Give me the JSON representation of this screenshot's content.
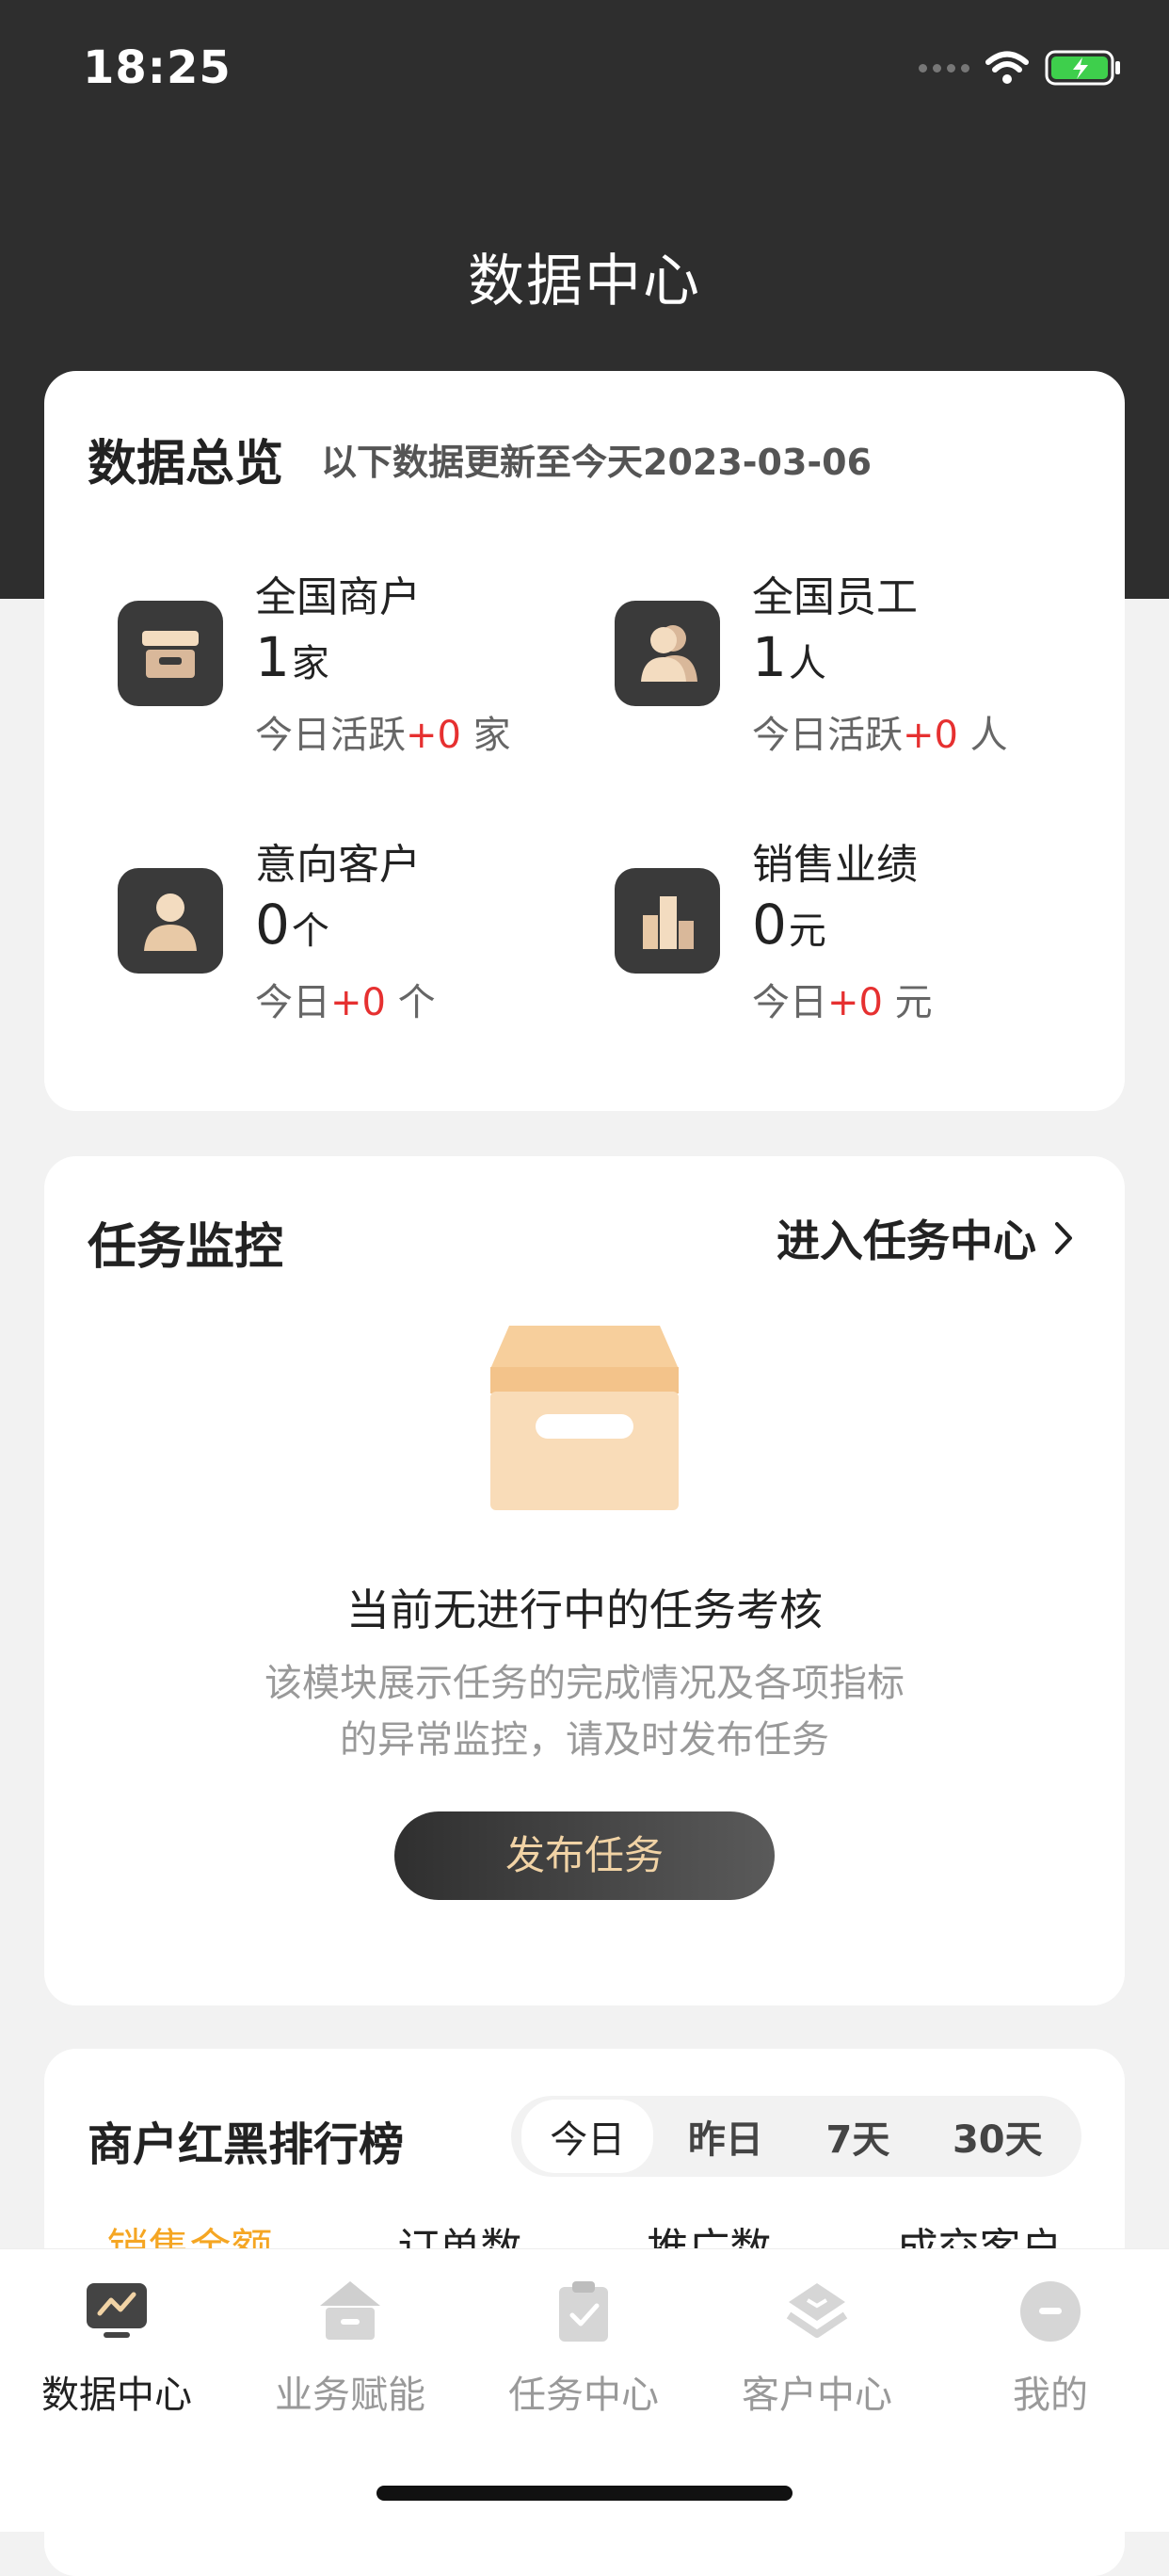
{
  "status": {
    "time": "18:25"
  },
  "page_title": "数据中心",
  "overview": {
    "title": "数据总览",
    "update_note": "以下数据更新至今天2023-03-06",
    "stats": [
      {
        "label": "全国商户",
        "value": "1",
        "unit": "家",
        "sub_prefix": "今日活跃",
        "sub_delta": "+0",
        "sub_unit": " 家",
        "icon": "store-icon"
      },
      {
        "label": "全国员工",
        "value": "1",
        "unit": "人",
        "sub_prefix": "今日活跃",
        "sub_delta": "+0",
        "sub_unit": " 人",
        "icon": "staff-icon"
      },
      {
        "label": "意向客户",
        "value": "0",
        "unit": "个",
        "sub_prefix": "今日",
        "sub_delta": "+0",
        "sub_unit": " 个",
        "icon": "customer-icon"
      },
      {
        "label": "销售业绩",
        "value": "0",
        "unit": "元",
        "sub_prefix": "今日",
        "sub_delta": "+0",
        "sub_unit": " 元",
        "icon": "sales-chart-icon"
      }
    ]
  },
  "task_monitor": {
    "title": "任务监控",
    "link_label": "进入任务中心",
    "empty_title": "当前无进行中的任务考核",
    "empty_desc_line1": "该模块展示任务的完成情况及各项指标",
    "empty_desc_line2": "的异常监控，请及时发布任务",
    "publish_label": "发布任务"
  },
  "ranking": {
    "title": "商户红黑排行榜",
    "periods": [
      "今日",
      "昨日",
      "7天",
      "30天"
    ],
    "active_period": "今日",
    "metrics": [
      "销售金额",
      "订单数",
      "推广数",
      "成交客户"
    ],
    "active_metric": "销售金额"
  },
  "tabbar": {
    "items": [
      {
        "label": "数据中心",
        "icon": "data-center-icon",
        "active": true
      },
      {
        "label": "业务赋能",
        "icon": "business-icon",
        "active": false
      },
      {
        "label": "任务中心",
        "icon": "task-icon",
        "active": false
      },
      {
        "label": "客户中心",
        "icon": "customer-center-icon",
        "active": false
      },
      {
        "label": "我的",
        "icon": "profile-icon",
        "active": false
      }
    ]
  },
  "colors": {
    "header": "#2e2e2e",
    "accent": "#f5a623",
    "delta": "#e63030",
    "button_text": "#f1d3a5"
  }
}
